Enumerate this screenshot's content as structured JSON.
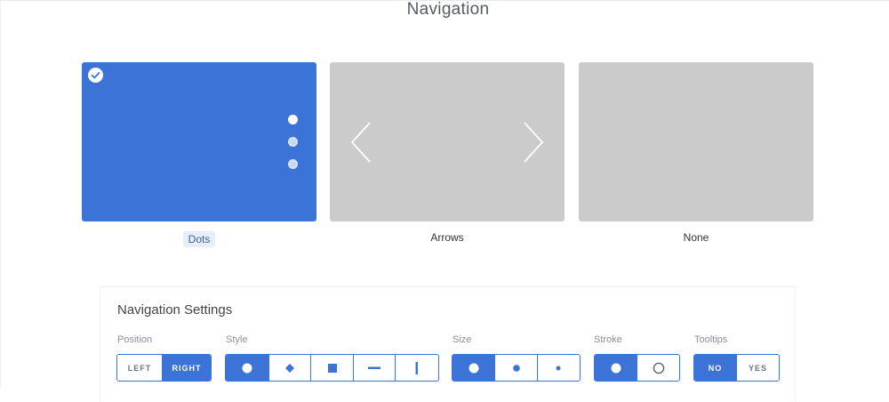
{
  "header": {
    "title": "Navigation"
  },
  "cards": [
    {
      "label": "Dots",
      "selected": true
    },
    {
      "label": "Arrows",
      "selected": false
    },
    {
      "label": "None",
      "selected": false
    }
  ],
  "settings": {
    "title": "Navigation Settings",
    "position": {
      "label": "Position",
      "options": [
        "LEFT",
        "RIGHT"
      ],
      "selected": "RIGHT"
    },
    "style": {
      "label": "Style",
      "options": [
        "circle",
        "diamond",
        "square",
        "horizontal-line",
        "vertical-line"
      ],
      "selected": "circle"
    },
    "size": {
      "label": "Size",
      "options": [
        "large",
        "medium",
        "small"
      ],
      "selected": "large"
    },
    "stroke": {
      "label": "Stroke",
      "options": [
        "filled",
        "outline"
      ],
      "selected": "filled"
    },
    "tooltips": {
      "label": "Tooltips",
      "options": [
        "NO",
        "YES"
      ],
      "selected": "NO"
    }
  },
  "colors": {
    "accent": "#3b73d6",
    "card_gray": "#cbcbcb",
    "pill_bg": "#e7eef9"
  }
}
